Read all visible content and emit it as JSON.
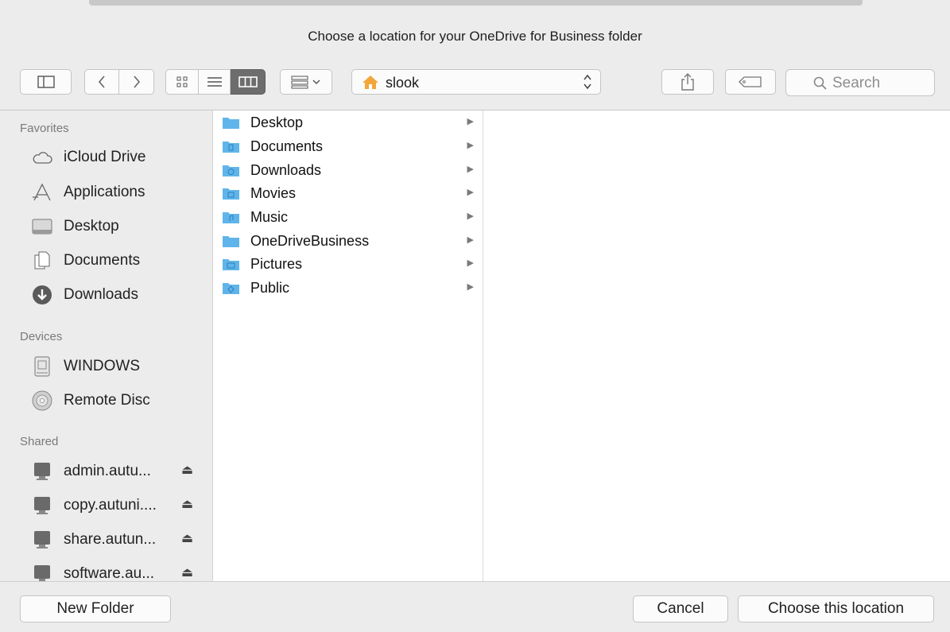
{
  "dialog": {
    "title": "Choose a location for your OneDrive for Business folder"
  },
  "toolbar": {
    "path_label": "slook",
    "search_placeholder": "Search"
  },
  "sidebar": {
    "favorites_header": "Favorites",
    "favorites": [
      {
        "label": "iCloud Drive",
        "icon": "cloud-icon"
      },
      {
        "label": "Applications",
        "icon": "applications-icon"
      },
      {
        "label": "Desktop",
        "icon": "desktop-icon"
      },
      {
        "label": "Documents",
        "icon": "documents-icon"
      },
      {
        "label": "Downloads",
        "icon": "downloads-icon"
      }
    ],
    "devices_header": "Devices",
    "devices": [
      {
        "label": "WINDOWS",
        "icon": "drive-icon"
      },
      {
        "label": "Remote Disc",
        "icon": "disc-icon"
      }
    ],
    "shared_header": "Shared",
    "shared": [
      {
        "label": "admin.autu...",
        "icon": "computer-icon"
      },
      {
        "label": "copy.autuni....",
        "icon": "computer-icon"
      },
      {
        "label": "share.autun...",
        "icon": "computer-icon"
      },
      {
        "label": "software.au...",
        "icon": "computer-icon"
      }
    ]
  },
  "browser": {
    "column1": [
      {
        "label": "Desktop"
      },
      {
        "label": "Documents"
      },
      {
        "label": "Downloads"
      },
      {
        "label": "Movies"
      },
      {
        "label": "Music"
      },
      {
        "label": "OneDriveBusiness"
      },
      {
        "label": "Pictures"
      },
      {
        "label": "Public"
      }
    ]
  },
  "footer": {
    "new_folder": "New Folder",
    "cancel": "Cancel",
    "choose": "Choose this location"
  },
  "colors": {
    "folder_blue": "#5fb5ea",
    "window_bg": "#ececec",
    "active_segment": "#6d6d6d"
  }
}
